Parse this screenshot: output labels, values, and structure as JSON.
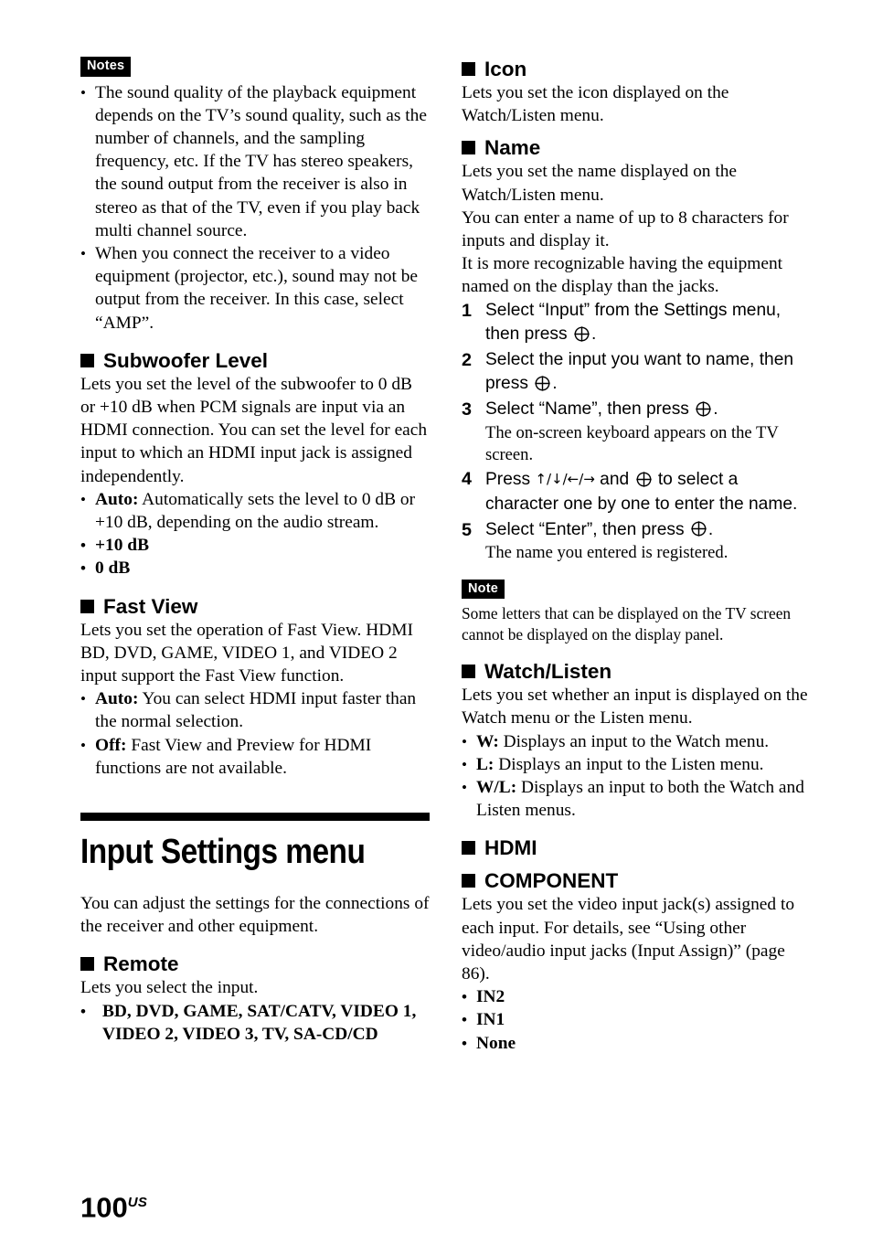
{
  "page": {
    "number": "100",
    "region_suffix": "US"
  },
  "left_column": {
    "notes_label": "Notes",
    "notes": [
      "The sound quality of the playback equipment depends on the TV’s sound quality, such as the number of channels, and the sampling frequency, etc. If the TV has stereo speakers, the sound output from the receiver is also in stereo as that of the TV, even if you play back multi channel source.",
      "When you connect the receiver to a video equipment (projector, etc.), sound may not be output from the receiver. In this case, select “AMP”."
    ],
    "subwoofer_level": {
      "heading": "Subwoofer Level",
      "body": "Lets you set the level of the subwoofer to 0 dB or +10 dB when PCM signals are input via an HDMI connection. You can set the level for each input to which an HDMI input jack is assigned independently.",
      "options": [
        {
          "term": "Auto:",
          "desc": " Automatically sets the level to 0 dB or +10 dB, depending on the audio stream."
        },
        {
          "term": "+10 dB",
          "desc": ""
        },
        {
          "term": "0 dB",
          "desc": ""
        }
      ]
    },
    "fast_view": {
      "heading": "Fast View",
      "body": "Lets you set the operation of Fast View. HDMI BD, DVD, GAME, VIDEO 1, and VIDEO 2 input support the Fast View function.",
      "options": [
        {
          "term": "Auto:",
          "desc": " You can select HDMI input faster than the normal selection."
        },
        {
          "term": "Off:",
          "desc": " Fast View and Preview for HDMI functions are not available."
        }
      ]
    },
    "chapter": {
      "title": "Input Settings menu",
      "intro": "You can adjust the settings for the connections of the receiver and other equipment."
    },
    "remote": {
      "heading": "Remote",
      "body": "Lets you select the input.",
      "options": [
        "BD, DVD, GAME, SAT/CATV, VIDEO 1, VIDEO 2, VIDEO 3, TV, SA-CD/CD"
      ]
    }
  },
  "right_column": {
    "icon": {
      "heading": "Icon",
      "body": "Lets you set the icon displayed on the Watch/Listen menu."
    },
    "name": {
      "heading": "Name",
      "body_lines": [
        "Lets you set the name displayed on the Watch/Listen menu.",
        "You can enter a name of up to 8 characters for inputs and display it.",
        "It is more recognizable having the equipment named on the display than the jacks."
      ],
      "steps": [
        {
          "num": "1",
          "text_before": "Select “Input” from the Settings menu, then press ",
          "icon": "enter-button-icon",
          "text_after": ".",
          "sub": ""
        },
        {
          "num": "2",
          "text_before": "Select the input you want to name, then press ",
          "icon": "enter-button-icon",
          "text_after": ".",
          "sub": ""
        },
        {
          "num": "3",
          "text_before": "Select “Name”, then press ",
          "icon": "enter-button-icon",
          "text_after": ".",
          "sub": "The on-screen keyboard appears on the TV screen."
        },
        {
          "num": "4",
          "text_before": "Press ",
          "arrows": "↑/↓/←/→",
          "text_mid": " and ",
          "icon": "enter-button-icon",
          "text_after": " to select a character one by one to enter the name.",
          "sub": ""
        },
        {
          "num": "5",
          "text_before": "Select “Enter”, then press ",
          "icon": "enter-button-icon",
          "text_after": ".",
          "sub": "The name you entered is registered."
        }
      ]
    },
    "note_label": "Note",
    "note_body": "Some letters that can be displayed on the TV screen cannot be displayed on the display panel.",
    "watch_listen": {
      "heading": "Watch/Listen",
      "body": "Lets you set whether an input is displayed on the Watch menu or the Listen menu.",
      "options": [
        {
          "term": "W:",
          "desc": " Displays an input to the Watch menu."
        },
        {
          "term": "L:",
          "desc": " Displays an input to the Listen menu."
        },
        {
          "term": "W/L:",
          "desc": " Displays an input to both the Watch and Listen menus."
        }
      ]
    },
    "hdmi": {
      "heading": "HDMI"
    },
    "component": {
      "heading": "COMPONENT",
      "body": "Lets you set the video input jack(s) assigned to each input. For details, see “Using other video/audio input jacks (Input Assign)” (page 86).",
      "options": [
        {
          "term": "IN2",
          "desc": ""
        },
        {
          "term": "IN1",
          "desc": ""
        },
        {
          "term": "None",
          "desc": ""
        }
      ]
    }
  }
}
